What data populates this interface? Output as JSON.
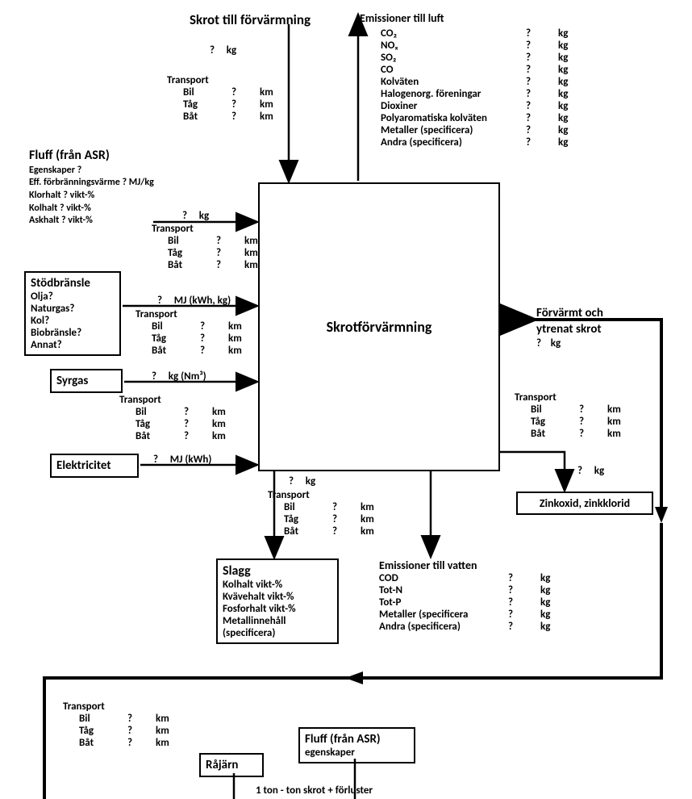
{
  "top": {
    "skrot": {
      "title": "Skrot till förvärmning",
      "val": "?",
      "unit": "kg"
    },
    "emissTitle": "Emissioner till luft",
    "emissions_air": [
      {
        "name": "CO₂",
        "val": "?",
        "unit": "kg"
      },
      {
        "name": "NOₓ",
        "val": "?",
        "unit": "kg"
      },
      {
        "name": "SO₂",
        "val": "?",
        "unit": "kg"
      },
      {
        "name": "CO",
        "val": "?",
        "unit": "kg"
      },
      {
        "name": "Kolväten",
        "val": "?",
        "unit": "kg"
      },
      {
        "name": "Halogenorg. föreningar",
        "val": "?",
        "unit": "kg"
      },
      {
        "name": "Dioxiner",
        "val": "?",
        "unit": "kg"
      },
      {
        "name": "Polyaromatiska kolväten",
        "val": "?",
        "unit": "kg"
      },
      {
        "name": "Metaller (specificera)",
        "val": "?",
        "unit": "kg"
      },
      {
        "name": "Andra (specificera)",
        "val": "?",
        "unit": "kg"
      }
    ],
    "transport_header": "Transport",
    "transport_items": [
      {
        "name": "Bil",
        "val": "?",
        "unit": "km"
      },
      {
        "name": "Tåg",
        "val": "?",
        "unit": "km"
      },
      {
        "name": "Båt",
        "val": "?",
        "unit": "km"
      }
    ]
  },
  "fluff": {
    "title": "Fluff (från ASR)",
    "props": [
      "Egenskaper ?",
      "Eff. förbränningsvärme  ? MJ/kg",
      "Klorhalt   ?  vikt-%",
      "Kolhalt   ?  vikt-%",
      "Askhalt  ?  vikt-%"
    ],
    "val": "?",
    "unit": "kg",
    "transport_header": "Transport",
    "transport_items": [
      {
        "name": "Bil",
        "val": "?",
        "unit": "km"
      },
      {
        "name": "Tåg",
        "val": "?",
        "unit": "km"
      },
      {
        "name": "Båt",
        "val": "?",
        "unit": "km"
      }
    ]
  },
  "stodbransle": {
    "title": "Stödbränsle",
    "props": [
      "Olja?",
      "Naturgas?",
      "Kol?",
      "Biobränsle?",
      "Annat?"
    ],
    "val": "?",
    "unit": "MJ (kWh, kg)",
    "transport_header": "Transport",
    "transport_items": [
      {
        "name": "Bil",
        "val": "?",
        "unit": "km"
      },
      {
        "name": "Tåg",
        "val": "?",
        "unit": "km"
      },
      {
        "name": "Båt",
        "val": "?",
        "unit": "km"
      }
    ]
  },
  "syrgas": {
    "title": "Syrgas",
    "val": "?",
    "unit": "kg (Nm³)",
    "transport_header": "Transport",
    "transport_items": [
      {
        "name": "Bil",
        "val": "?",
        "unit": "km"
      },
      {
        "name": "Tåg",
        "val": "?",
        "unit": "km"
      },
      {
        "name": "Båt",
        "val": "?",
        "unit": "km"
      }
    ]
  },
  "el": {
    "title": "Elektricitet",
    "val": "?",
    "unit": "MJ (kWh)"
  },
  "center": {
    "title": "Skrotförvärmning"
  },
  "right": {
    "forvarmt": {
      "title1": "Förvärmt och",
      "title2": "ytrenat skrot",
      "val": "?",
      "unit": "kg"
    },
    "transport_header": "Transport",
    "transport_items": [
      {
        "name": "Bil",
        "val": "?",
        "unit": "km"
      },
      {
        "name": "Tåg",
        "val": "?",
        "unit": "km"
      },
      {
        "name": "Båt",
        "val": "?",
        "unit": "km"
      }
    ],
    "zink_val": "?",
    "zink_unit": "kg",
    "zink_title": "Zinkoxid, zinkklorid"
  },
  "bottom": {
    "slag_amount": {
      "val": "?",
      "unit": "kg"
    },
    "transport_header": "Transport",
    "transport_items": [
      {
        "name": "Bil",
        "val": "?",
        "unit": "km"
      },
      {
        "name": "Tåg",
        "val": "?",
        "unit": "km"
      },
      {
        "name": "Båt",
        "val": "?",
        "unit": "km"
      }
    ],
    "slagg": {
      "title": "Slagg",
      "props": [
        "Kolhalt    vikt-%",
        "Kvävehalt vikt-%",
        "Fosforhalt vikt-%",
        "Metallinnehåll",
        "(specificera)"
      ]
    },
    "water_title": "Emissioner till vatten",
    "emissions_water": [
      {
        "name": "COD",
        "val": "?",
        "unit": "kg"
      },
      {
        "name": "Tot-N",
        "val": "?",
        "unit": "kg"
      },
      {
        "name": "Tot-P",
        "val": "?",
        "unit": "kg"
      },
      {
        "name": "Metaller (specificera",
        "val": "?",
        "unit": "kg"
      },
      {
        "name": "Andra (specificera)",
        "val": "?",
        "unit": "kg"
      }
    ]
  },
  "last": {
    "transport_header": "Transport",
    "transport_items": [
      {
        "name": "Bil",
        "val": "?",
        "unit": "km"
      },
      {
        "name": "Tåg",
        "val": "?",
        "unit": "km"
      },
      {
        "name": "Båt",
        "val": "?",
        "unit": "km"
      }
    ],
    "rajarn": "Råjärn",
    "fluff_box": {
      "title": "Fluff (från ASR)",
      "sub": "egenskaper"
    },
    "formula": "1 ton - ton skrot + förluster"
  }
}
